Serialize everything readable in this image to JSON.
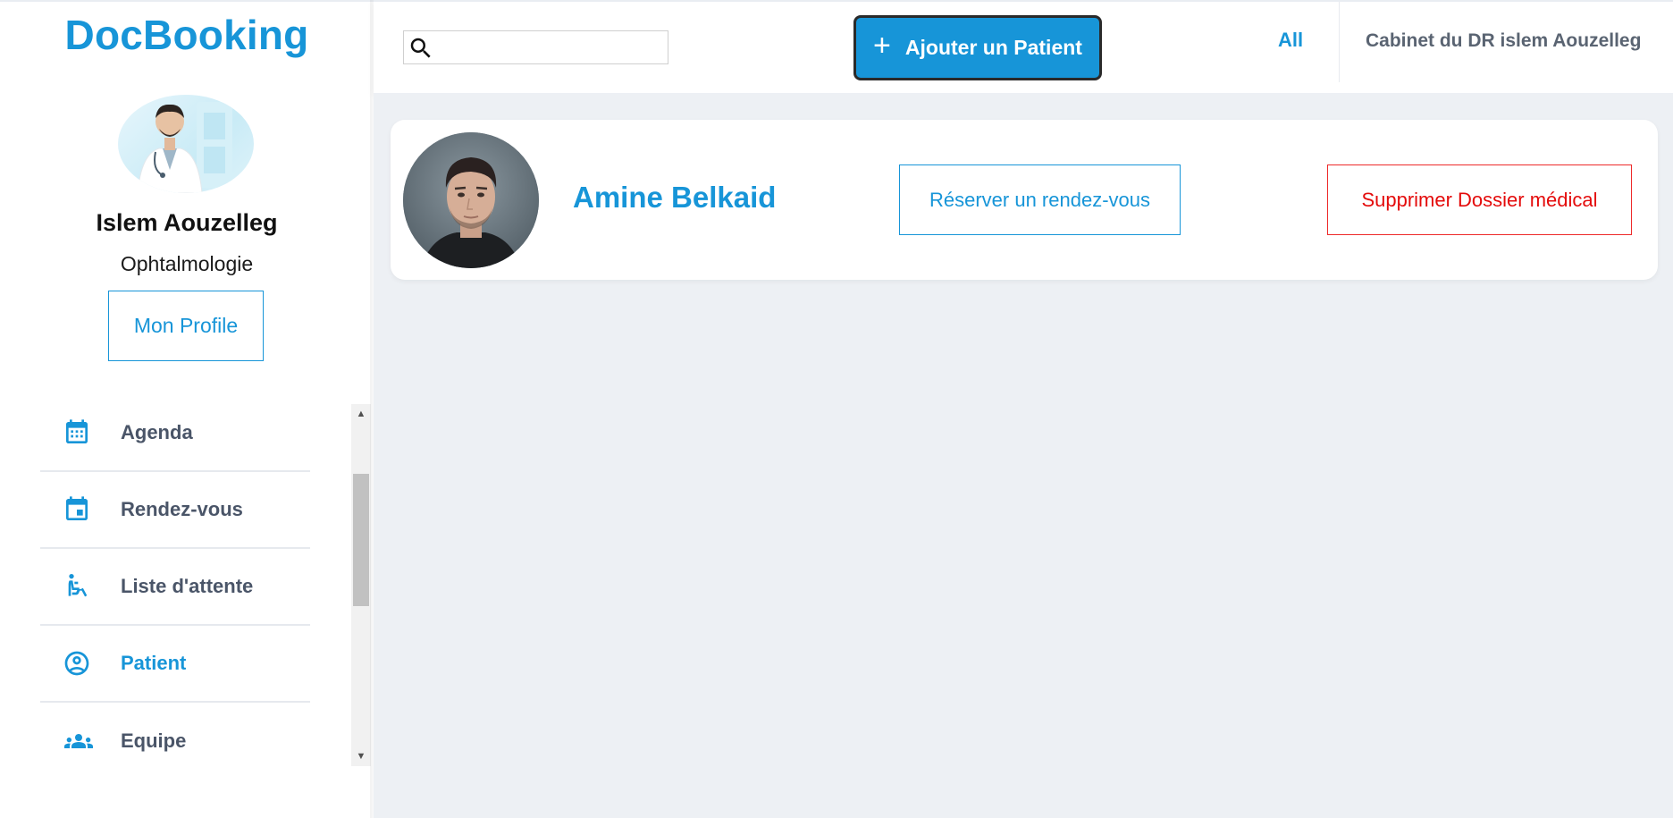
{
  "app": {
    "brand": "DocBooking"
  },
  "doctor": {
    "name": "Islem Aouzelleg",
    "specialty": "Ophtalmologie",
    "profile_button": "Mon Profile"
  },
  "sidebar": {
    "items": [
      {
        "label": "Agenda",
        "icon": "calendar-grid-icon",
        "active": false
      },
      {
        "label": "Rendez-vous",
        "icon": "calendar-event-icon",
        "active": false
      },
      {
        "label": "Liste d'attente",
        "icon": "wheelchair-icon",
        "active": false
      },
      {
        "label": "Patient",
        "icon": "account-circle-icon",
        "active": true
      },
      {
        "label": "Equipe",
        "icon": "group-icon",
        "active": false
      }
    ]
  },
  "topbar": {
    "search": {
      "value": "",
      "placeholder": ""
    },
    "add_patient_label": "Ajouter un Patient",
    "filter_label": "All",
    "cabinet_label": "Cabinet du DR islem Aouzelleg"
  },
  "patients": [
    {
      "name": "Amine Belkaid",
      "book_label": "Réserver un rendez-vous",
      "delete_label": "Supprimer Dossier médical"
    }
  ],
  "colors": {
    "accent": "#1795d8",
    "danger": "#e40b0b",
    "nav_text": "#4a5568",
    "main_bg": "#edf0f4"
  }
}
